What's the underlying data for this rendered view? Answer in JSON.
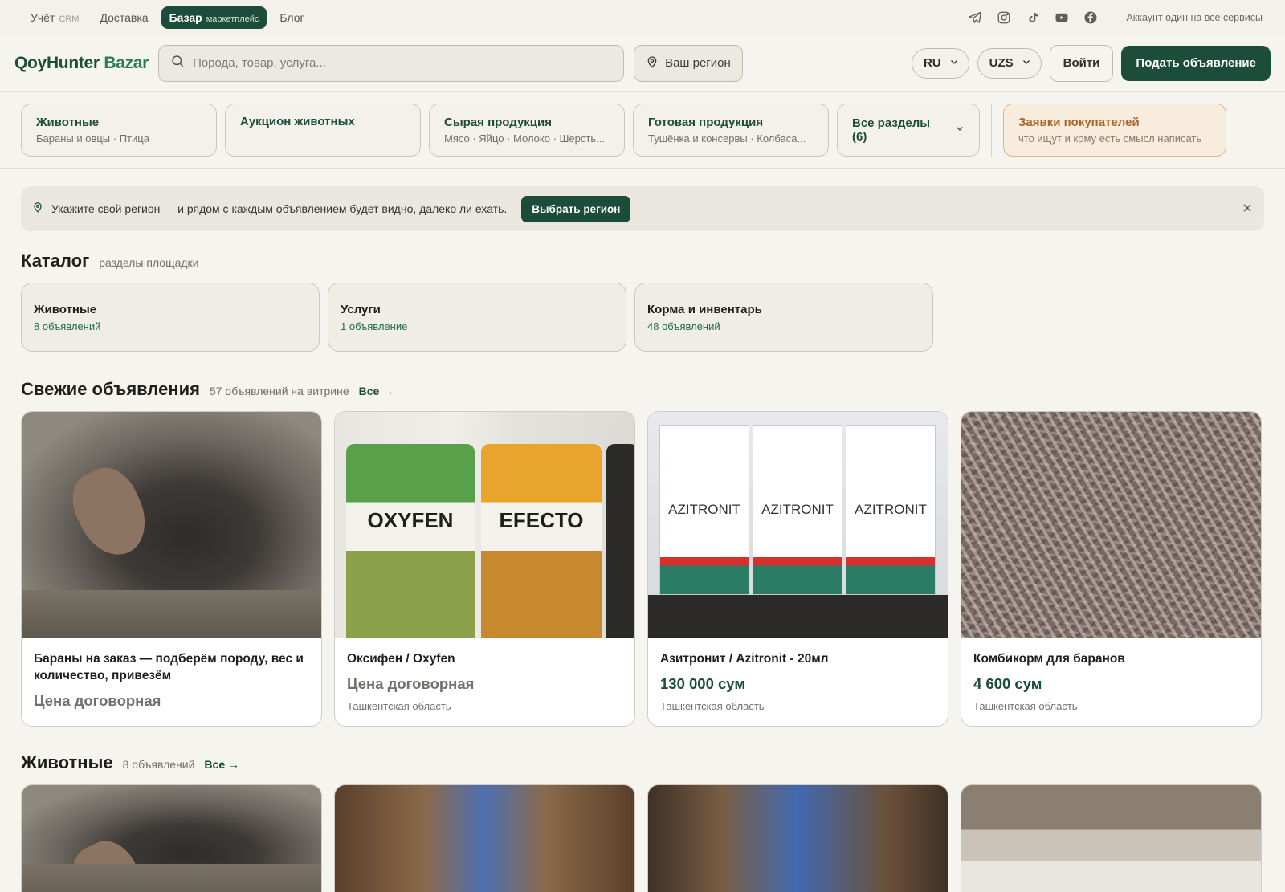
{
  "topnav": [
    {
      "label": "Учёт",
      "sub": "CRM",
      "active": false
    },
    {
      "label": "Доставка",
      "sub": "",
      "active": false
    },
    {
      "label": "Базар",
      "sub": "маркетплейс",
      "active": true
    },
    {
      "label": "Блог",
      "sub": "",
      "active": false
    }
  ],
  "social_icons": [
    "telegram-icon",
    "instagram-icon",
    "tiktok-icon",
    "youtube-icon",
    "facebook-icon"
  ],
  "account_note": "Аккаунт один на все сервисы",
  "header": {
    "logo_main": "QoyHunter",
    "logo_sub": "Bazar",
    "search_placeholder": "Порода, товар, услуга...",
    "region_label": "Ваш регион",
    "lang": "RU",
    "currency": "UZS",
    "login": "Войти",
    "post": "Подать объявление"
  },
  "categories": [
    {
      "title": "Животные",
      "sub": "Бараны и овцы · Птица"
    },
    {
      "title": "Аукцион животных",
      "sub": ""
    },
    {
      "title": "Сырая продукция",
      "sub": "Мясо · Яйцо · Молоко · Шерсть..."
    },
    {
      "title": "Готовая продукция",
      "sub": "Тушёнка и консервы · Колбаса..."
    }
  ],
  "all_sections": "Все разделы (6)",
  "buyers": {
    "title": "Заявки покупателей",
    "sub": "что ищут и кому есть смысл написать"
  },
  "banner": {
    "text": "Укажите свой регион — и рядом с каждым объявлением будет видно, далеко ли ехать.",
    "button": "Выбрать регион"
  },
  "catalog": {
    "title": "Каталог",
    "sub": "разделы площадки",
    "cards": [
      {
        "title": "Животные",
        "count": "8 объявлений"
      },
      {
        "title": "Услуги",
        "count": "1 объявление"
      },
      {
        "title": "Корма и инвентарь",
        "count": "48 объявлений"
      }
    ]
  },
  "fresh": {
    "title": "Свежие объявления",
    "sub": "57 объявлений на витрине",
    "link": "Все →",
    "listings": [
      {
        "title": "Бараны на заказ — подберём породу, вес и количество, привезём",
        "price": "Цена договорная",
        "region": ""
      },
      {
        "title": "Оксифен / Oxyfen",
        "price": "Цена договорная",
        "region": "Ташкентская область"
      },
      {
        "title": "Азитронит / Azitronit - 20мл",
        "price": "130 000 сум",
        "region": "Ташкентская область"
      },
      {
        "title": "Комбикорм для баранов",
        "price": "4 600 сум",
        "region": "Ташкентская область"
      }
    ]
  },
  "animals": {
    "title": "Животные",
    "sub": "8 объявлений",
    "link": "Все →"
  },
  "image_text": {
    "bottle1": "OXYFEN",
    "bottle2": "EFECTO",
    "box": "AZITRONIT"
  }
}
